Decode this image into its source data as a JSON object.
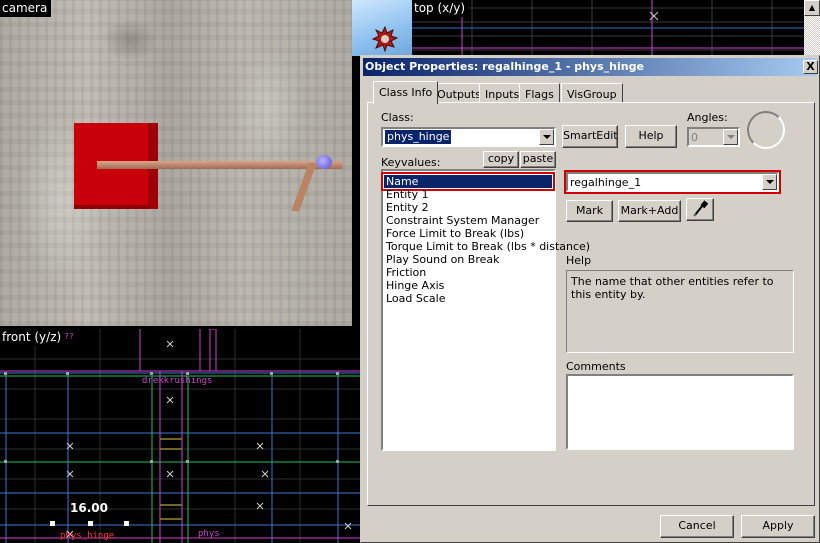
{
  "viewports": {
    "camera_label": "camera",
    "top_label": "top (x/y)",
    "front_label": "front (y/z)",
    "front_texts": {
      "entity1": "drekkrushings",
      "measure": "16.00",
      "entity2": "phys_hinge",
      "entity3": "phys",
      "small_mark": "??"
    }
  },
  "dialog": {
    "title": "Object Properties: regalhinge_1 - phys_hinge",
    "close_label": "X",
    "tabs": [
      {
        "label": "Class Info",
        "active": true
      },
      {
        "label": "Outputs",
        "active": false
      },
      {
        "label": "Inputs",
        "active": false
      },
      {
        "label": "Flags",
        "active": false
      },
      {
        "label": "VisGroup",
        "active": false
      }
    ],
    "class_label": "Class:",
    "class_value": "phys_hinge",
    "smartedit_label": "SmartEdit",
    "help_button_label": "Help",
    "angles_label": "Angles:",
    "angles_value": "0",
    "keyvalues_label": "Keyvalues:",
    "copy_label": "copy",
    "paste_label": "paste",
    "keyvalues": [
      "Name",
      "Entity 1",
      "Entity 2",
      "Constraint System Manager",
      "Force Limit to Break (lbs)",
      "Torque Limit to Break (lbs * distance)",
      "Play Sound on Break",
      "Friction",
      "Hinge Axis",
      "Load Scale"
    ],
    "selected_value": "regalhinge_1",
    "mark_label": "Mark",
    "mark_add_label": "Mark+Add",
    "help_section_label": "Help",
    "help_text": "The name that other entities refer to this entity by.",
    "comments_label": "Comments",
    "cancel_label": "Cancel",
    "apply_label": "Apply"
  },
  "colors": {
    "titlebar_start": "#0a246a",
    "titlebar_end": "#a6caf0",
    "highlight_outline": "#d00000",
    "entity_red": "#c8000a",
    "grid_magenta": "#d040d0"
  }
}
